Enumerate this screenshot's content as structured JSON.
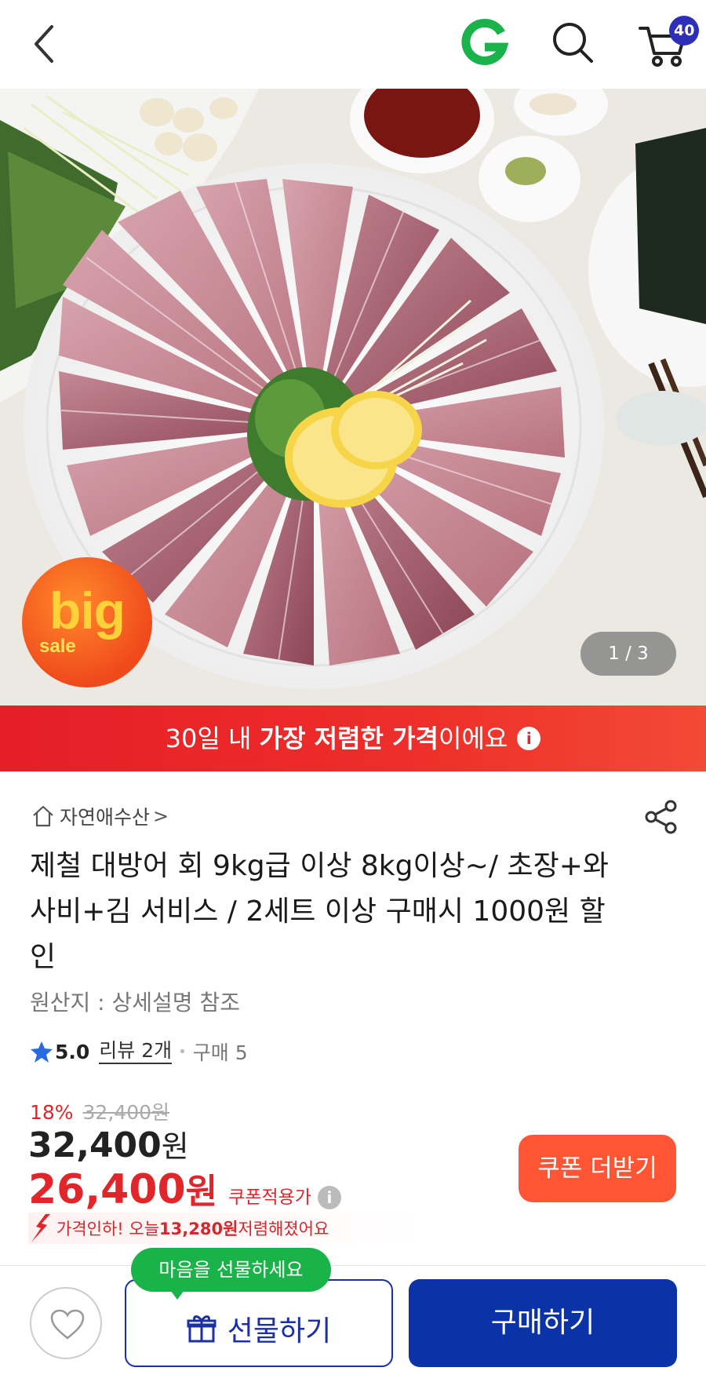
{
  "header": {
    "cart_count": "40",
    "brand_color": "#1ab24b"
  },
  "hero": {
    "pager": "1 / 3",
    "badge_big": "big",
    "badge_sale": "sale"
  },
  "banner": {
    "prefix": "30일 내 ",
    "bold": "가장 저렴한 가격",
    "suffix": "이에요",
    "info_icon": "i"
  },
  "product": {
    "store_name": "자연애수산",
    "store_chevron": ">",
    "title": "제철 대방어 회 9kg급 이상 8kg이상~/ 초장+와사비+김 서비스 / 2세트 이상 구매시 1000원 할인",
    "origin": "원산지 : 상세설명 참조",
    "rating_score": "5.0",
    "reviews": "리뷰 2개",
    "purchases": "구매 5"
  },
  "pricing": {
    "discount_pct": "18%",
    "original_price": "32,400원",
    "price_amount": "32,400",
    "price_unit": "원",
    "coupon_amount": "26,400",
    "coupon_unit": "원",
    "coupon_label": "쿠폰적용가",
    "coupon_button": "쿠폰 더받기",
    "drop_prefix": "가격인하! 오늘 ",
    "drop_amount": "13,280원",
    "drop_suffix": " 저렴해졌어요",
    "accent_color": "#e0262a"
  },
  "bottom_bar": {
    "gift_tooltip": "마음을 선물하세요",
    "gift_button": "선물하기",
    "buy_button": "구매하기",
    "primary_color": "#0a33a8"
  }
}
